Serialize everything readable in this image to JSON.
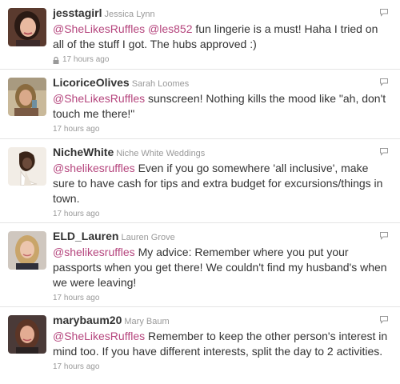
{
  "tweets": [
    {
      "screen_name": "jesstagirl",
      "full_name": "Jessica Lynn",
      "mentions": [
        "@SheLikesRuffles",
        "@les852"
      ],
      "text": "fun lingerie is a must! Haha I tried on all of the stuff I got. The hubs approved :)",
      "time": "17 hours ago",
      "protected": true,
      "avatar_colors": {
        "bg": "#5a3a2e",
        "face": "#e8b9a0",
        "hair": "#2a1a14"
      }
    },
    {
      "screen_name": "LicoriceOlives",
      "full_name": "Sarah Loomes",
      "mentions": [
        "@SheLikesRuffles"
      ],
      "text": "sunscreen! Nothing kills the mood like \"ah, don't touch me there!\"",
      "time": "17 hours ago",
      "protected": false,
      "avatar_colors": {
        "bg": "#c9b99a",
        "face": "#d9a98a",
        "hair": "#8a6b3f"
      }
    },
    {
      "screen_name": "NicheWhite",
      "full_name": "Niche White Weddings",
      "mentions": [
        "@shelikesruffles"
      ],
      "text": "Even if you go somewhere 'all inclusive', make sure to have cash for tips and extra budget for excursions/things in town.",
      "time": "17 hours ago",
      "protected": false,
      "avatar_colors": {
        "bg": "#f2ede6",
        "face": "#6b4a3a",
        "hair": "#3a2418"
      }
    },
    {
      "screen_name": "ELD_Lauren",
      "full_name": "Lauren Grove",
      "mentions": [
        "@shelikesruffles"
      ],
      "text": "My advice: Remember where you put your passports when you get there! We couldn't find my husband's when we were leaving!",
      "time": "17 hours ago",
      "protected": false,
      "avatar_colors": {
        "bg": "#cfc7bf",
        "face": "#ecc5ad",
        "hair": "#c9a56a"
      }
    },
    {
      "screen_name": "marybaum20",
      "full_name": "Mary Baum",
      "mentions": [
        "@SheLikesRuffles"
      ],
      "text": "Remember to keep the other person's interest in mind too. If you have different interests, split the day to 2 activities.",
      "time": "17 hours ago",
      "protected": false,
      "avatar_colors": {
        "bg": "#4a3a38",
        "face": "#e3ac93",
        "hair": "#5c3526"
      }
    }
  ],
  "colors": {
    "mention": "#b5457d",
    "meta": "#999999",
    "divider": "#e3e3e3"
  },
  "icons": {
    "reply": "reply-icon",
    "lock": "lock-icon"
  }
}
